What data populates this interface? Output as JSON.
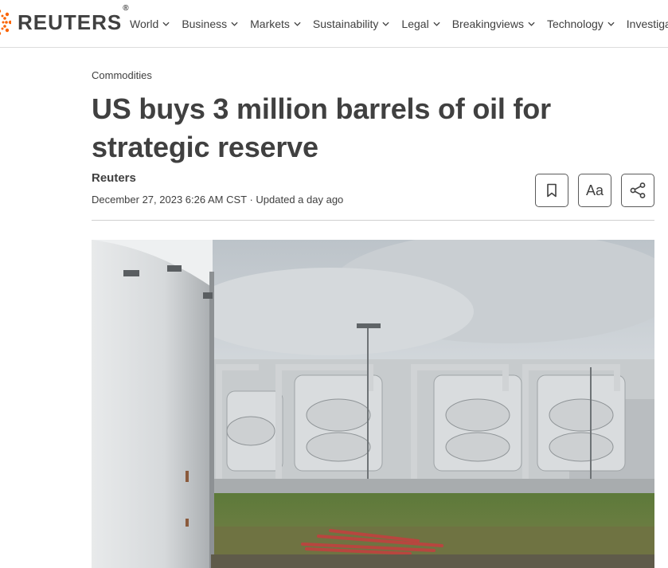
{
  "brand": {
    "name": "REUTERS",
    "registered": "®"
  },
  "nav": {
    "items": [
      {
        "label": "World"
      },
      {
        "label": "Business"
      },
      {
        "label": "Markets"
      },
      {
        "label": "Sustainability"
      },
      {
        "label": "Legal"
      },
      {
        "label": "Breakingviews"
      },
      {
        "label": "Technology"
      },
      {
        "label": "Investigations"
      }
    ]
  },
  "article": {
    "kicker": "Commodities",
    "headline": "US buys 3 million barrels of oil for strategic reserve",
    "byline": "Reuters",
    "dateline": "December 27, 2023 6:26 AM CST · Updated a day ago",
    "text_size_label": "Aa"
  },
  "icons": {
    "bookmark": "bookmark-icon",
    "share": "share-icon",
    "chevron": "chevron-down-icon"
  },
  "colors": {
    "brand_orange": "#fa6400",
    "text": "#404040"
  }
}
